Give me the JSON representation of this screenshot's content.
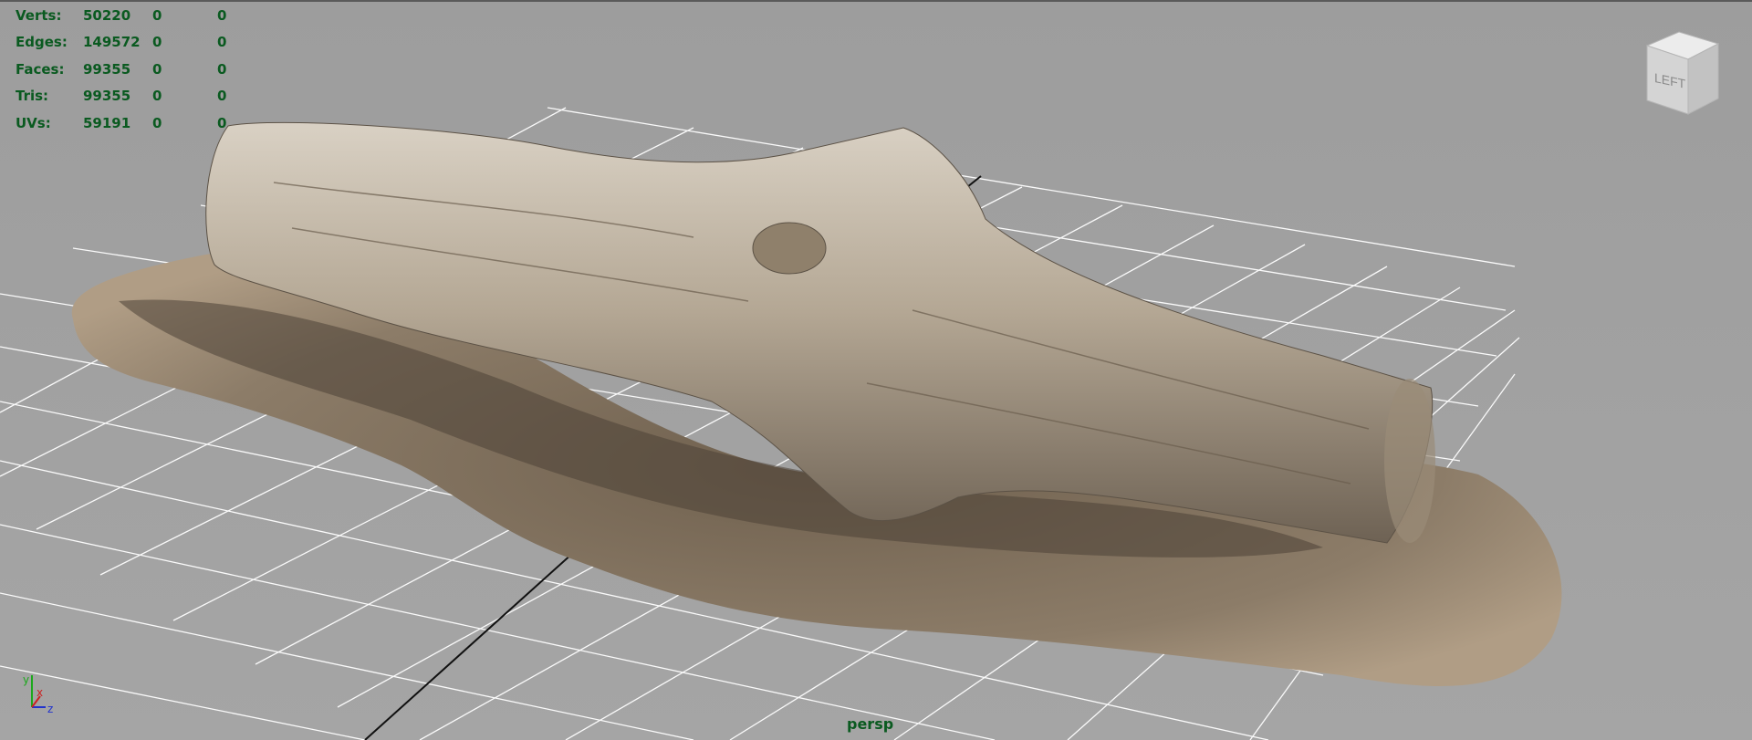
{
  "hud": {
    "rows": [
      {
        "label": "Verts:",
        "v1": "50220",
        "v2": "0",
        "v3": "0"
      },
      {
        "label": "Edges:",
        "v1": "149572",
        "v2": "0",
        "v3": "0"
      },
      {
        "label": "Faces:",
        "v1": "99355",
        "v2": "0",
        "v3": "0"
      },
      {
        "label": "Tris:",
        "v1": "99355",
        "v2": "0",
        "v3": "0"
      },
      {
        "label": "UVs:",
        "v1": "59191",
        "v2": "0",
        "v3": "0"
      }
    ]
  },
  "viewcube": {
    "face_label": "LEFT",
    "color": "#d8d8d8"
  },
  "camera": {
    "label": "persp"
  },
  "axis_gizmo": {
    "x": "x",
    "y": "y",
    "z": "z"
  },
  "colors": {
    "background": "#a0a0a0",
    "grid": "#ffffff",
    "hud_text": "#0a5a20",
    "log_wood": "#b7a994",
    "ground": "#8a7a66"
  },
  "icons": [
    "viewcube-icon",
    "axis-gizmo-icon"
  ]
}
